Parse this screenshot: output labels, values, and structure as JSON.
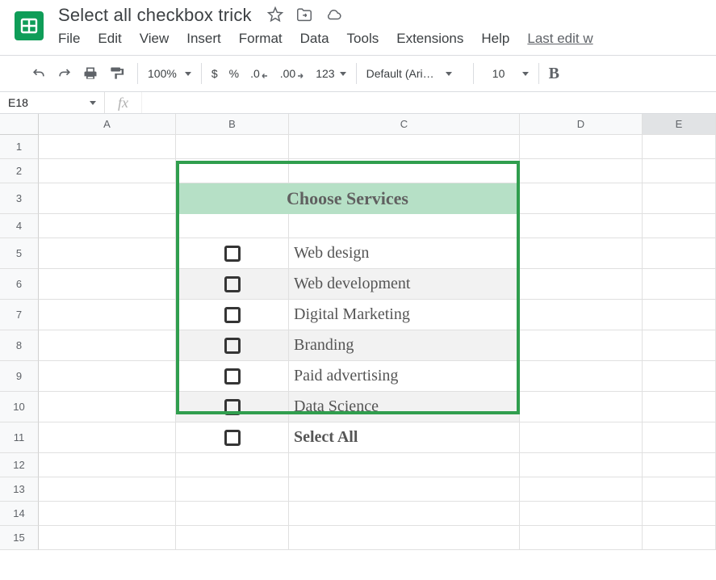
{
  "header": {
    "title": "Select all checkbox trick"
  },
  "menus": {
    "file": "File",
    "edit": "Edit",
    "view": "View",
    "insert": "Insert",
    "format": "Format",
    "data": "Data",
    "tools": "Tools",
    "extensions": "Extensions",
    "help": "Help",
    "last_edit": "Last edit w"
  },
  "toolbar": {
    "zoom": "100%",
    "currency": "$",
    "percent": "%",
    "dec_dec": ".0",
    "dec_inc": ".00",
    "more_formats": "123",
    "font": "Default (Ari…",
    "font_size": "10",
    "bold": "B"
  },
  "fxbar": {
    "namebox": "E18",
    "fx": "fx"
  },
  "columns": [
    "A",
    "B",
    "C",
    "D",
    "E"
  ],
  "row_numbers": [
    "1",
    "2",
    "3",
    "4",
    "5",
    "6",
    "7",
    "8",
    "9",
    "10",
    "11",
    "12",
    "13",
    "14",
    "15"
  ],
  "services": {
    "heading": "Choose Services",
    "items": [
      "Web design",
      "Web development",
      "Digital Marketing",
      "Branding",
      "Paid advertising",
      "Data Science"
    ],
    "select_all": "Select All"
  }
}
